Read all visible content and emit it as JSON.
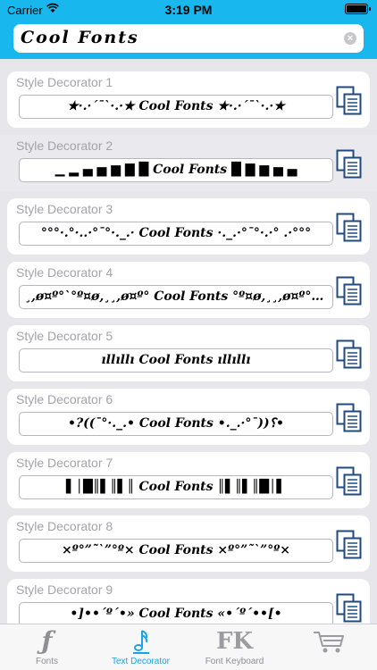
{
  "status": {
    "carrier": "Carrier",
    "time": "3:19 PM"
  },
  "search": {
    "value": "Cool Fonts"
  },
  "rows": [
    {
      "label": "Style Decorator 1",
      "preview": "★·.·´¯`·.·★ Cool Fonts ★·.·´¯`·.·★"
    },
    {
      "label": "Style Decorator 2",
      "preview": "▁ ▂ ▄ ▅ ▆ ▇ █ Cool Fonts █ ▇ ▆ ▅ ▄"
    },
    {
      "label": "Style Decorator 3",
      "preview": "°°°·.°·..·°¯°·._.· Cool Fonts ·._.·°¯°·.·° .·°°°"
    },
    {
      "label": "Style Decorator 4",
      "preview": "¸,ø¤º°`°º¤ø,¸¸,ø¤º° Cool Fonts °º¤ø,¸¸,ø¤º°`°º¤ø,¸"
    },
    {
      "label": "Style Decorator 5",
      "preview": "ıllıllı Cool Fonts ıllıllı"
    },
    {
      "label": "Style Decorator 6",
      "preview": "•?((¯°·._.• Cool Fonts •._.·°¯))؟•"
    },
    {
      "label": "Style Decorator 7",
      "preview": "▌│█║▌║▌║ Cool Fonts ║▌║▌║█│▌"
    },
    {
      "label": "Style Decorator 8",
      "preview": "×º°”˜`”°º× Cool Fonts ×º°”˜`”°º×"
    },
    {
      "label": "Style Decorator 9",
      "preview": "•]••´º´•» Cool Fonts «•´º´••[•"
    }
  ],
  "tabs": [
    {
      "label": "Fonts",
      "icon": "f-icon"
    },
    {
      "label": "Text Decorator",
      "icon": "music-note-icon"
    },
    {
      "label": "Font Keyboard",
      "icon": "fk-icon"
    },
    {
      "label": "",
      "icon": "cart-icon"
    }
  ],
  "colors": {
    "accent": "#18b8ef",
    "tab_active": "#1aa3e8",
    "copy_icon": "#1f4a80"
  }
}
